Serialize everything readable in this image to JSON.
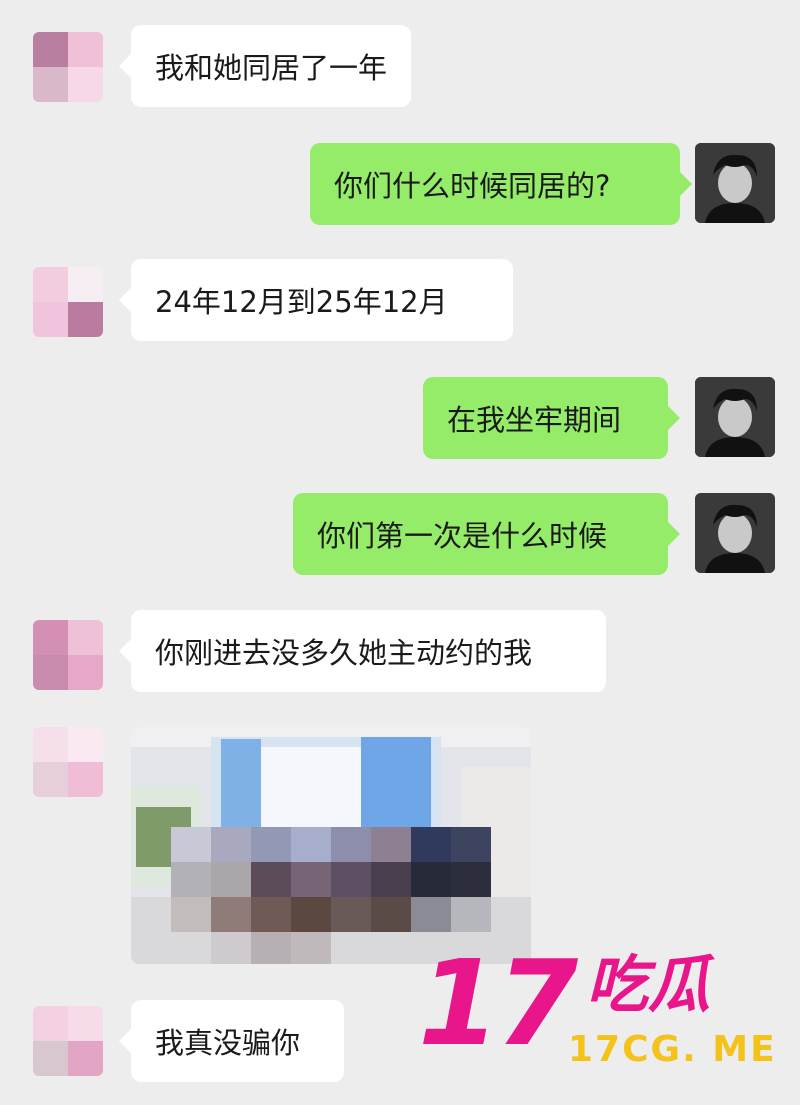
{
  "messages": [
    {
      "side": "in",
      "text": "我和她同居了一年"
    },
    {
      "side": "out",
      "text": "你们什么时候同居的?"
    },
    {
      "side": "in",
      "text": "24年12月到25年12月"
    },
    {
      "side": "out",
      "text": "在我坐牢期间"
    },
    {
      "side": "out",
      "text": "你们第一次是什么时候"
    },
    {
      "side": "in",
      "text": "你刚进去没多久她主动约的我"
    },
    {
      "side": "in",
      "type": "image",
      "description_icon": "blurred-photo"
    },
    {
      "side": "in",
      "text": "我真没骗你"
    }
  ],
  "watermark": {
    "number": "17",
    "chinese": "吃瓜",
    "site": "17CG. ME"
  },
  "colors": {
    "background": "#ededed",
    "incoming_bubble": "#ffffff",
    "outgoing_bubble": "#95ec69",
    "watermark_pink": "#e8168a",
    "watermark_yellow": "#f3c21b"
  }
}
